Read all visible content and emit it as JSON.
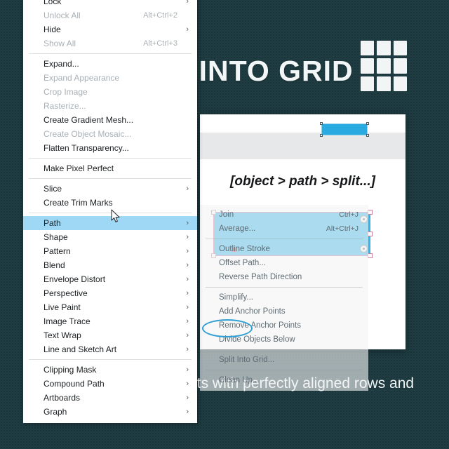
{
  "theme": {
    "background": "#1e3c42",
    "accent_blue": "#29abe2",
    "selection_blue": "#9ed8f5",
    "annotation_blue": "#2d9fd4",
    "text_light": "#f2f6f6"
  },
  "poster": {
    "title": "SPLIT INTO GRID",
    "body": "creating layouts with perfectly aligned rows and columns.",
    "grid_icon": "grid-3x3-icon"
  },
  "panel": {
    "caption": "[object > path > split...]",
    "chip_label": ""
  },
  "object_menu": {
    "name": "object-context-menu",
    "items": [
      {
        "label": "Lock",
        "shortcut": "",
        "arrow": true,
        "disabled": false,
        "selected": false,
        "separator_after": false
      },
      {
        "label": "Unlock All",
        "shortcut": "Alt+Ctrl+2",
        "arrow": false,
        "disabled": true,
        "selected": false,
        "separator_after": false
      },
      {
        "label": "Hide",
        "shortcut": "",
        "arrow": true,
        "disabled": false,
        "selected": false,
        "separator_after": false
      },
      {
        "label": "Show All",
        "shortcut": "Alt+Ctrl+3",
        "arrow": false,
        "disabled": true,
        "selected": false,
        "separator_after": true
      },
      {
        "label": "Expand...",
        "shortcut": "",
        "arrow": false,
        "disabled": false,
        "selected": false,
        "separator_after": false
      },
      {
        "label": "Expand Appearance",
        "shortcut": "",
        "arrow": false,
        "disabled": true,
        "selected": false,
        "separator_after": false
      },
      {
        "label": "Crop Image",
        "shortcut": "",
        "arrow": false,
        "disabled": true,
        "selected": false,
        "separator_after": false
      },
      {
        "label": "Rasterize...",
        "shortcut": "",
        "arrow": false,
        "disabled": true,
        "selected": false,
        "separator_after": false
      },
      {
        "label": "Create Gradient Mesh...",
        "shortcut": "",
        "arrow": false,
        "disabled": false,
        "selected": false,
        "separator_after": false
      },
      {
        "label": "Create Object Mosaic...",
        "shortcut": "",
        "arrow": false,
        "disabled": true,
        "selected": false,
        "separator_after": false
      },
      {
        "label": "Flatten Transparency...",
        "shortcut": "",
        "arrow": false,
        "disabled": false,
        "selected": false,
        "separator_after": true
      },
      {
        "label": "Make Pixel Perfect",
        "shortcut": "",
        "arrow": false,
        "disabled": false,
        "selected": false,
        "separator_after": true
      },
      {
        "label": "Slice",
        "shortcut": "",
        "arrow": true,
        "disabled": false,
        "selected": false,
        "separator_after": false
      },
      {
        "label": "Create Trim Marks",
        "shortcut": "",
        "arrow": false,
        "disabled": false,
        "selected": false,
        "separator_after": true
      },
      {
        "label": "Path",
        "shortcut": "",
        "arrow": true,
        "disabled": false,
        "selected": true,
        "separator_after": false
      },
      {
        "label": "Shape",
        "shortcut": "",
        "arrow": true,
        "disabled": false,
        "selected": false,
        "separator_after": false
      },
      {
        "label": "Pattern",
        "shortcut": "",
        "arrow": true,
        "disabled": false,
        "selected": false,
        "separator_after": false
      },
      {
        "label": "Blend",
        "shortcut": "",
        "arrow": true,
        "disabled": false,
        "selected": false,
        "separator_after": false
      },
      {
        "label": "Envelope Distort",
        "shortcut": "",
        "arrow": true,
        "disabled": false,
        "selected": false,
        "separator_after": false
      },
      {
        "label": "Perspective",
        "shortcut": "",
        "arrow": true,
        "disabled": false,
        "selected": false,
        "separator_after": false
      },
      {
        "label": "Live Paint",
        "shortcut": "",
        "arrow": true,
        "disabled": false,
        "selected": false,
        "separator_after": false
      },
      {
        "label": "Image Trace",
        "shortcut": "",
        "arrow": true,
        "disabled": false,
        "selected": false,
        "separator_after": false
      },
      {
        "label": "Text Wrap",
        "shortcut": "",
        "arrow": true,
        "disabled": false,
        "selected": false,
        "separator_after": false
      },
      {
        "label": "Line and Sketch Art",
        "shortcut": "",
        "arrow": true,
        "disabled": false,
        "selected": false,
        "separator_after": true
      },
      {
        "label": "Clipping Mask",
        "shortcut": "",
        "arrow": true,
        "disabled": false,
        "selected": false,
        "separator_after": false
      },
      {
        "label": "Compound Path",
        "shortcut": "",
        "arrow": true,
        "disabled": false,
        "selected": false,
        "separator_after": false
      },
      {
        "label": "Artboards",
        "shortcut": "",
        "arrow": true,
        "disabled": false,
        "selected": false,
        "separator_after": false
      },
      {
        "label": "Graph",
        "shortcut": "",
        "arrow": true,
        "disabled": false,
        "selected": false,
        "separator_after": false
      }
    ]
  },
  "path_submenu": {
    "name": "path-flyout-menu",
    "items": [
      {
        "label": "Join",
        "shortcut": "Ctrl+J",
        "separator_after": false
      },
      {
        "label": "Average...",
        "shortcut": "Alt+Ctrl+J",
        "separator_after": true
      },
      {
        "label": "Outline Stroke",
        "shortcut": "",
        "separator_after": false
      },
      {
        "label": "Offset Path...",
        "shortcut": "",
        "separator_after": false
      },
      {
        "label": "Reverse Path Direction",
        "shortcut": "",
        "separator_after": true
      },
      {
        "label": "Simplify...",
        "shortcut": "",
        "separator_after": false
      },
      {
        "label": "Add Anchor Points",
        "shortcut": "",
        "separator_after": false
      },
      {
        "label": "Remove Anchor Points",
        "shortcut": "",
        "separator_after": false
      },
      {
        "label": "Divide Objects Below",
        "shortcut": "",
        "separator_after": true
      },
      {
        "label": "Split Into Grid...",
        "shortcut": "",
        "separator_after": true
      },
      {
        "label": "Clean Up...",
        "shortcut": "",
        "separator_after": false
      }
    ]
  },
  "cursor": {
    "name": "mouse-pointer"
  }
}
